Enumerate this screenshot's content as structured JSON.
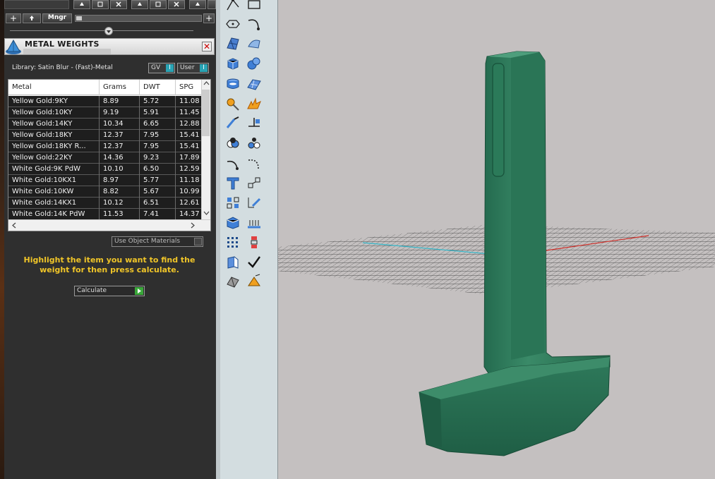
{
  "toolbar_top": {
    "mngr_label": "Mngr",
    "plus_label": "+"
  },
  "panel": {
    "title": "METAL WEIGHTS",
    "close_glyph": "✕",
    "library_label": "Library: Satin Blur - (Fast)-Metal",
    "gv_label": "GV",
    "user_label": "User",
    "toggle_indicator": "I"
  },
  "table": {
    "headers": [
      "Metal",
      "Grams",
      "DWT",
      "SPG"
    ],
    "rows": [
      [
        "Yellow Gold:9KY",
        "8.89",
        "5.72",
        "11.08"
      ],
      [
        "Yellow Gold:10KY",
        "9.19",
        "5.91",
        "11.45"
      ],
      [
        "Yellow Gold:14KY",
        "10.34",
        "6.65",
        "12.88"
      ],
      [
        "Yellow Gold:18KY",
        "12.37",
        "7.95",
        "15.41"
      ],
      [
        "Yellow Gold:18KY R...",
        "12.37",
        "7.95",
        "15.41"
      ],
      [
        "Yellow Gold:22KY",
        "14.36",
        "9.23",
        "17.89"
      ],
      [
        "White Gold:9K PdW",
        "10.10",
        "6.50",
        "12.59"
      ],
      [
        "White Gold:10KX1",
        "8.97",
        "5.77",
        "11.18"
      ],
      [
        "White Gold:10KW",
        "8.82",
        "5.67",
        "10.99"
      ],
      [
        "White Gold:14KX1",
        "10.12",
        "6.51",
        "12.61"
      ],
      [
        "White Gold:14K PdW",
        "11.53",
        "7.41",
        "14.37"
      ]
    ]
  },
  "use_object_materials_label": "Use Object Materials",
  "hint_text": "Highlight the item you want to find the weight for then press calculate.",
  "calculate_label": "Calculate",
  "colors": {
    "model_green": "#2f7a5c",
    "viewport_bg": "#c4c0c0",
    "hint_yellow": "#f0c528",
    "toggle_teal": "#29a3b4"
  }
}
